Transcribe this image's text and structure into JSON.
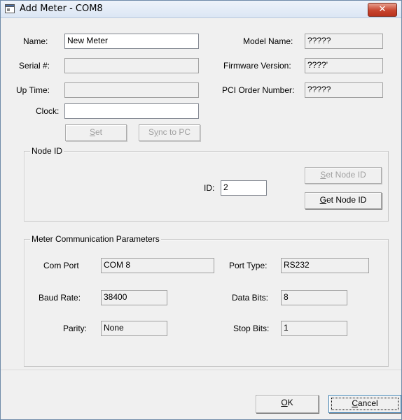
{
  "window": {
    "title": "Add Meter - COM8",
    "close_glyph": "✕"
  },
  "meter_info": {
    "name_label": "Name:",
    "name_value": "New Meter",
    "serial_label": "Serial #:",
    "serial_value": "",
    "uptime_label": "Up Time:",
    "uptime_value": "",
    "clock_label": "Clock:",
    "clock_value": "",
    "model_label": "Model Name:",
    "model_value": "?????",
    "firmware_label": "Firmware Version:",
    "firmware_value": "????'",
    "pci_label": "PCI Order Number:",
    "pci_value": "?????",
    "set_key": "S",
    "set_rest": "et",
    "sync_pre": "S",
    "sync_key": "y",
    "sync_rest": "nc to PC"
  },
  "node_id": {
    "group_label": "Node ID",
    "id_label": "ID:",
    "id_value": "2",
    "set_key": "S",
    "set_rest": "et Node ID",
    "get_key": "G",
    "get_rest": "et Node ID"
  },
  "comm": {
    "group_label": "Meter Communication Parameters",
    "com_port_label": "Com Port",
    "com_port_value": "COM 8",
    "port_type_label": "Port Type:",
    "port_type_value": "RS232",
    "baud_label": "Baud Rate:",
    "baud_value": "38400",
    "data_bits_label": "Data Bits:",
    "data_bits_value": "8",
    "parity_label": "Parity:",
    "parity_value": "None",
    "stop_bits_label": "Stop Bits:",
    "stop_bits_value": "1"
  },
  "footer": {
    "ok_key": "O",
    "ok_rest": "K",
    "cancel_key": "C",
    "cancel_rest": "ancel"
  }
}
